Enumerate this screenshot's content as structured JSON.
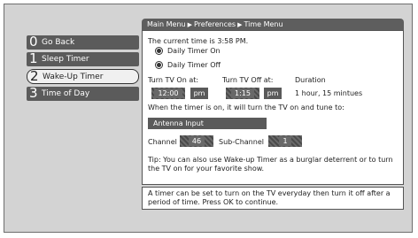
{
  "breadcrumb": [
    "Main Menu",
    "Preferences",
    "Time Menu"
  ],
  "menu": [
    {
      "num": "0",
      "label": "Go Back"
    },
    {
      "num": "1",
      "label": "Sleep Timer"
    },
    {
      "num": "2",
      "label": "Wake-Up Timer",
      "selected": true
    },
    {
      "num": "3",
      "label": "Time of Day"
    }
  ],
  "panel": {
    "current_time": "The current time is 3:58 PM.",
    "option_on": "Daily Timer On",
    "option_off": "Daily Timer Off",
    "turn_on_label": "Turn TV On at:",
    "turn_off_label": "Turn TV Off at:",
    "duration_label": "Duration",
    "on_time": "12:00",
    "on_ampm": "pm",
    "off_time": "1:15",
    "off_ampm": "pm",
    "duration_value": "1 hour, 15 mintues",
    "tune_text": "When the timer is on, it will turn the TV on and tune to:",
    "input_value": "Antenna Input",
    "channel_label": "Channel",
    "channel_value": "46",
    "subchannel_label": "Sub-Channel",
    "subchannel_value": "1",
    "tip": "Tip: You can also use Wake-up Timer as a burglar deterrent or to turn the TV on for your favorite show."
  },
  "info": "A timer can be set to turn on the TV everyday then turn it off after a period of time. Press OK to continue."
}
